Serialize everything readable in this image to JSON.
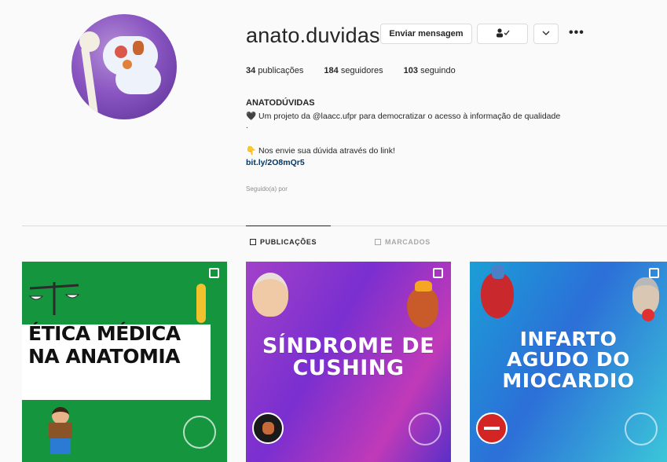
{
  "profile": {
    "username": "anato.duvidas",
    "message_button": "Enviar mensagem",
    "follow_icon": "person-check-icon",
    "more_label": "•••",
    "stats": [
      {
        "count": "34",
        "label": "publicações"
      },
      {
        "count": "184",
        "label": "seguidores"
      },
      {
        "count": "103",
        "label": "seguindo"
      }
    ],
    "bio_name": "ANATODÚVIDAS",
    "bio_line1": "🖤 Um projeto da @laacc.ufpr para democratizar o acesso à informação de qualidade",
    "bio_dot": ".",
    "bio_line2": "👇 Nos envie sua dúvida através do link!",
    "bio_link": "bit.ly/2O8mQr5",
    "followed_by": "Seguido(a) por"
  },
  "tabs": [
    {
      "label": "PUBLICAÇÕES",
      "active": true
    },
    {
      "label": "MARCADOS",
      "active": false
    }
  ],
  "posts": [
    {
      "title": "ÉTICA MÉDICA NA ANATOMIA",
      "line1": "ÉTICA MÉDICA",
      "line2": "NA ANATOMIA",
      "bg": "#15953e"
    },
    {
      "title": "SÍNDROME DE CUSHING",
      "line1": "SÍNDROME DE",
      "line2": "CUSHING",
      "bg": "#8a36c8"
    },
    {
      "title": "INFARTO AGUDO DO MIOCARDIO",
      "line1": "INFARTO",
      "line2": "AGUDO DO",
      "line3": "MIOCARDIO",
      "bg": "#2a8ad6"
    }
  ],
  "colors": {
    "link": "#00376b",
    "muted": "#8e8e8e",
    "border": "#dbdbdb"
  }
}
